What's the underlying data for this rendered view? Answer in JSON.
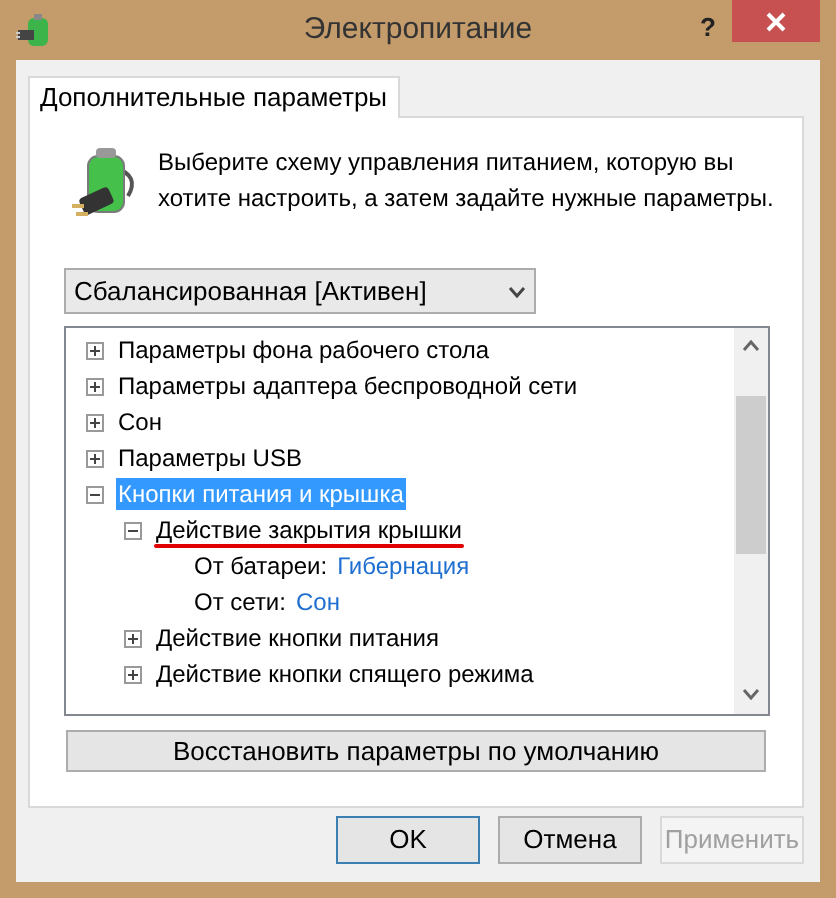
{
  "window": {
    "title": "Электропитание",
    "help_button": "?"
  },
  "tabs": [
    {
      "label": "Дополнительные параметры",
      "selected": true
    }
  ],
  "description": "Выберите схему управления питанием, которую вы хотите настроить, а затем задайте нужные параметры.",
  "plan_dropdown": {
    "value": "Сбалансированная [Активен]"
  },
  "tree": [
    {
      "label": "Параметры фона рабочего стола",
      "expanded": false,
      "selected": false
    },
    {
      "label": "Параметры адаптера беспроводной сети",
      "expanded": false,
      "selected": false
    },
    {
      "label": "Сон",
      "expanded": false,
      "selected": false
    },
    {
      "label": "Параметры USB",
      "expanded": false,
      "selected": false
    },
    {
      "label": "Кнопки питания и крышка",
      "expanded": true,
      "selected": true,
      "children": [
        {
          "label": "Действие закрытия крышки",
          "expanded": true,
          "selected": false,
          "underlined": true,
          "children": [
            {
              "kind": "setting",
              "label": "От батареи:",
              "value": "Гибернация"
            },
            {
              "kind": "setting",
              "label": "От сети:",
              "value": "Сон"
            }
          ]
        },
        {
          "label": "Действие кнопки питания",
          "expanded": false,
          "selected": false
        },
        {
          "label": "Действие кнопки спящего режима",
          "expanded": false,
          "selected": false
        }
      ]
    }
  ],
  "restore_button": "Восстановить параметры по умолчанию",
  "buttons": [
    {
      "label": "OK",
      "kind": "default"
    },
    {
      "label": "Отмена",
      "kind": "normal"
    },
    {
      "label": "Применить",
      "kind": "disabled"
    }
  ]
}
